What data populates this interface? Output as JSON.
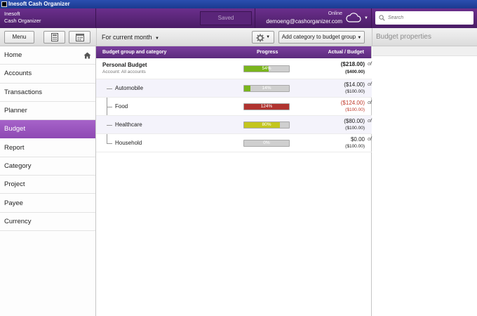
{
  "window": {
    "title": "Inesoft Cash Organizer"
  },
  "header": {
    "brand_line1": "Inesoft",
    "brand_line2": "Cash Organizer",
    "saved_label": "Saved",
    "status": "Online",
    "email": "demoeng@cashorganizer.com",
    "search_placeholder": "Search"
  },
  "toolbar": {
    "menu_label": "Menu",
    "calculator_icon": "calculator-icon",
    "calendar_icon": "calendar-icon",
    "period_label": "For current month",
    "add_category_label": "Add category to budget group",
    "properties_title": "Budget properties"
  },
  "sidebar": {
    "items": [
      {
        "label": "Home",
        "icon": "home-icon"
      },
      {
        "label": "Accounts"
      },
      {
        "label": "Transactions"
      },
      {
        "label": "Planner"
      },
      {
        "label": "Budget",
        "active": true
      },
      {
        "label": "Report"
      },
      {
        "label": "Category"
      },
      {
        "label": "Project"
      },
      {
        "label": "Payee"
      },
      {
        "label": "Currency"
      }
    ]
  },
  "table": {
    "headers": {
      "group": "Budget group and category",
      "progress": "Progress",
      "actual": "Actual / Budget"
    },
    "of_label": "of",
    "group_row": {
      "name": "Personal Budget",
      "account": "Account: All accounts",
      "progress_text": "54%",
      "progress": 0.54,
      "actual": "($218.00)",
      "budget": "($400.00)"
    },
    "rows": [
      {
        "name": "Automobile",
        "progress_text": "14%",
        "progress": 0.14,
        "actual": "($14.00)",
        "budget": "($100.00)",
        "color": "#7ab51d",
        "over": false
      },
      {
        "name": "Food",
        "progress_text": "124%",
        "progress": 1.0,
        "actual": "($124.00)",
        "budget": "($100.00)",
        "color": "#b0332f",
        "over": true
      },
      {
        "name": "Healthcare",
        "progress_text": "80%",
        "progress": 0.8,
        "actual": "($80.00)",
        "budget": "($100.00)",
        "color": "#c3c51d",
        "over": false
      },
      {
        "name": "Household",
        "progress_text": "0%",
        "progress": 0.0,
        "actual": "$0.00",
        "budget": "($100.00)",
        "color": "#7ab51d",
        "over": false
      }
    ]
  },
  "colors": {
    "accent_purple": "#6b2f8c",
    "active_nav": "#9b56c0",
    "green": "#7ab51d",
    "red": "#b0332f",
    "yellow_green": "#c3c51d",
    "over_text": "#c0392b"
  }
}
